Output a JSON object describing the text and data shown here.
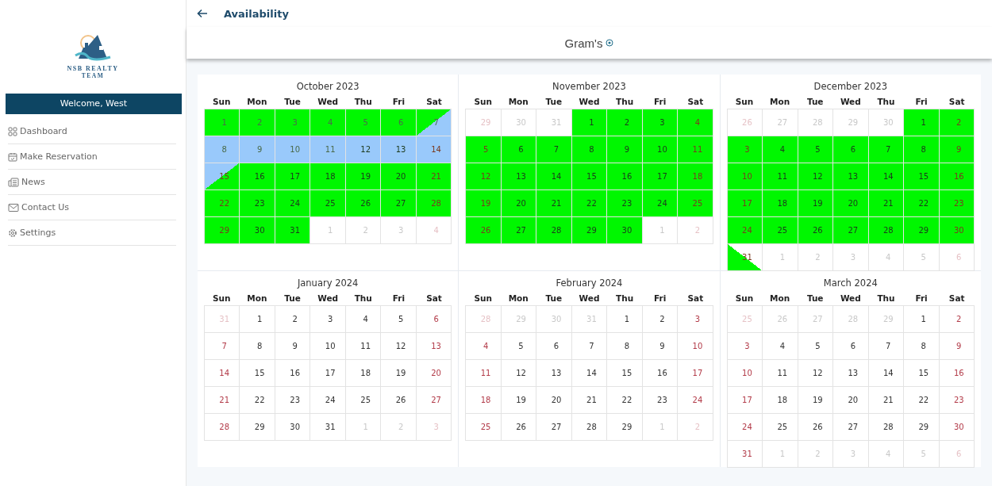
{
  "sidebar": {
    "logo_text": "NSB REALTY",
    "logo_subtext": "TEAM",
    "welcome": "Welcome, West",
    "items": [
      {
        "label": "Dashboard"
      },
      {
        "label": "Make Reservation"
      },
      {
        "label": "News"
      },
      {
        "label": "Contact Us"
      },
      {
        "label": "Settings"
      }
    ]
  },
  "header": {
    "title": "Availability",
    "property": "Gram's"
  },
  "months": [
    {
      "title": "October 2023",
      "weekdays": [
        "Sun",
        "Mon",
        "Tue",
        "Wed",
        "Thu",
        "Fri",
        "Sat"
      ],
      "weeks": [
        [
          {
            "d": "1",
            "kind": "green",
            "dim": true
          },
          {
            "d": "2",
            "kind": "green",
            "dim": true
          },
          {
            "d": "3",
            "kind": "green",
            "dim": true
          },
          {
            "d": "4",
            "kind": "green",
            "dim": true
          },
          {
            "d": "5",
            "kind": "green",
            "dim": true
          },
          {
            "d": "6",
            "kind": "green",
            "dim": true
          },
          {
            "d": "7",
            "kind": "green-blue",
            "dim": true
          }
        ],
        [
          {
            "d": "8",
            "kind": "blue",
            "dim": true
          },
          {
            "d": "9",
            "kind": "blue",
            "dim": true
          },
          {
            "d": "10",
            "kind": "blue",
            "dim": true
          },
          {
            "d": "11",
            "kind": "blue",
            "dim": true
          },
          {
            "d": "12",
            "kind": "blue",
            "dim": false
          },
          {
            "d": "13",
            "kind": "blue",
            "dim": false
          },
          {
            "d": "14",
            "kind": "blue",
            "dim": false
          }
        ],
        [
          {
            "d": "15",
            "kind": "blue-green",
            "dim": false
          },
          {
            "d": "16",
            "kind": "green",
            "dim": false
          },
          {
            "d": "17",
            "kind": "green",
            "dim": false
          },
          {
            "d": "18",
            "kind": "green",
            "dim": false
          },
          {
            "d": "19",
            "kind": "green",
            "dim": false
          },
          {
            "d": "20",
            "kind": "green",
            "dim": false
          },
          {
            "d": "21",
            "kind": "green",
            "dim": false
          }
        ],
        [
          {
            "d": "22",
            "kind": "green",
            "dim": false
          },
          {
            "d": "23",
            "kind": "green",
            "dim": false
          },
          {
            "d": "24",
            "kind": "green",
            "dim": false
          },
          {
            "d": "25",
            "kind": "green",
            "dim": false
          },
          {
            "d": "26",
            "kind": "green",
            "dim": false
          },
          {
            "d": "27",
            "kind": "green",
            "dim": false
          },
          {
            "d": "28",
            "kind": "green",
            "dim": false
          }
        ],
        [
          {
            "d": "29",
            "kind": "green",
            "dim": false
          },
          {
            "d": "30",
            "kind": "green",
            "dim": false
          },
          {
            "d": "31",
            "kind": "green",
            "dim": false
          },
          {
            "d": "1",
            "kind": "free",
            "dim": true
          },
          {
            "d": "2",
            "kind": "free",
            "dim": true
          },
          {
            "d": "3",
            "kind": "free",
            "dim": true
          },
          {
            "d": "4",
            "kind": "free",
            "dim": true
          }
        ]
      ]
    },
    {
      "title": "November 2023",
      "weekdays": [
        "Sun",
        "Mon",
        "Tue",
        "Wed",
        "Thu",
        "Fri",
        "Sat"
      ],
      "weeks": [
        [
          {
            "d": "29",
            "kind": "free",
            "dim": true
          },
          {
            "d": "30",
            "kind": "free",
            "dim": true
          },
          {
            "d": "31",
            "kind": "free",
            "dim": true
          },
          {
            "d": "1",
            "kind": "green",
            "dim": false
          },
          {
            "d": "2",
            "kind": "green",
            "dim": false
          },
          {
            "d": "3",
            "kind": "green",
            "dim": false
          },
          {
            "d": "4",
            "kind": "green",
            "dim": false
          }
        ],
        [
          {
            "d": "5",
            "kind": "green",
            "dim": false
          },
          {
            "d": "6",
            "kind": "green",
            "dim": false
          },
          {
            "d": "7",
            "kind": "green",
            "dim": false
          },
          {
            "d": "8",
            "kind": "green",
            "dim": false
          },
          {
            "d": "9",
            "kind": "green",
            "dim": false
          },
          {
            "d": "10",
            "kind": "green",
            "dim": false
          },
          {
            "d": "11",
            "kind": "green",
            "dim": false
          }
        ],
        [
          {
            "d": "12",
            "kind": "green",
            "dim": false
          },
          {
            "d": "13",
            "kind": "green",
            "dim": false
          },
          {
            "d": "14",
            "kind": "green",
            "dim": false
          },
          {
            "d": "15",
            "kind": "green",
            "dim": false
          },
          {
            "d": "16",
            "kind": "green",
            "dim": false
          },
          {
            "d": "17",
            "kind": "green",
            "dim": false
          },
          {
            "d": "18",
            "kind": "green",
            "dim": false
          }
        ],
        [
          {
            "d": "19",
            "kind": "green",
            "dim": false
          },
          {
            "d": "20",
            "kind": "green",
            "dim": false
          },
          {
            "d": "21",
            "kind": "green",
            "dim": false
          },
          {
            "d": "22",
            "kind": "green",
            "dim": false
          },
          {
            "d": "23",
            "kind": "green",
            "dim": false
          },
          {
            "d": "24",
            "kind": "green",
            "dim": false
          },
          {
            "d": "25",
            "kind": "green",
            "dim": false
          }
        ],
        [
          {
            "d": "26",
            "kind": "green",
            "dim": false
          },
          {
            "d": "27",
            "kind": "green",
            "dim": false
          },
          {
            "d": "28",
            "kind": "green",
            "dim": false
          },
          {
            "d": "29",
            "kind": "green",
            "dim": false
          },
          {
            "d": "30",
            "kind": "green",
            "dim": false
          },
          {
            "d": "1",
            "kind": "free",
            "dim": true
          },
          {
            "d": "2",
            "kind": "free",
            "dim": true
          }
        ]
      ]
    },
    {
      "title": "December 2023",
      "weekdays": [
        "Sun",
        "Mon",
        "Tue",
        "Wed",
        "Thu",
        "Fri",
        "Sat"
      ],
      "weeks": [
        [
          {
            "d": "26",
            "kind": "free",
            "dim": true
          },
          {
            "d": "27",
            "kind": "free",
            "dim": true
          },
          {
            "d": "28",
            "kind": "free",
            "dim": true
          },
          {
            "d": "29",
            "kind": "free",
            "dim": true
          },
          {
            "d": "30",
            "kind": "free",
            "dim": true
          },
          {
            "d": "1",
            "kind": "green",
            "dim": false
          },
          {
            "d": "2",
            "kind": "green",
            "dim": false
          }
        ],
        [
          {
            "d": "3",
            "kind": "green",
            "dim": false
          },
          {
            "d": "4",
            "kind": "green",
            "dim": false
          },
          {
            "d": "5",
            "kind": "green",
            "dim": false
          },
          {
            "d": "6",
            "kind": "green",
            "dim": false
          },
          {
            "d": "7",
            "kind": "green",
            "dim": false
          },
          {
            "d": "8",
            "kind": "green",
            "dim": false
          },
          {
            "d": "9",
            "kind": "green",
            "dim": false
          }
        ],
        [
          {
            "d": "10",
            "kind": "green",
            "dim": false
          },
          {
            "d": "11",
            "kind": "green",
            "dim": false
          },
          {
            "d": "12",
            "kind": "green",
            "dim": false
          },
          {
            "d": "13",
            "kind": "green",
            "dim": false
          },
          {
            "d": "14",
            "kind": "green",
            "dim": false
          },
          {
            "d": "15",
            "kind": "green",
            "dim": false
          },
          {
            "d": "16",
            "kind": "green",
            "dim": false
          }
        ],
        [
          {
            "d": "17",
            "kind": "green",
            "dim": false
          },
          {
            "d": "18",
            "kind": "green",
            "dim": false
          },
          {
            "d": "19",
            "kind": "green",
            "dim": false
          },
          {
            "d": "20",
            "kind": "green",
            "dim": false
          },
          {
            "d": "21",
            "kind": "green",
            "dim": false
          },
          {
            "d": "22",
            "kind": "green",
            "dim": false
          },
          {
            "d": "23",
            "kind": "green",
            "dim": false
          }
        ],
        [
          {
            "d": "24",
            "kind": "green",
            "dim": false
          },
          {
            "d": "25",
            "kind": "green",
            "dim": false
          },
          {
            "d": "26",
            "kind": "green",
            "dim": false
          },
          {
            "d": "27",
            "kind": "green",
            "dim": false
          },
          {
            "d": "28",
            "kind": "green",
            "dim": false
          },
          {
            "d": "29",
            "kind": "green",
            "dim": false
          },
          {
            "d": "30",
            "kind": "green",
            "dim": false
          }
        ],
        [
          {
            "d": "31",
            "kind": "green-free",
            "dim": false
          },
          {
            "d": "1",
            "kind": "free",
            "dim": true
          },
          {
            "d": "2",
            "kind": "free",
            "dim": true
          },
          {
            "d": "3",
            "kind": "free",
            "dim": true
          },
          {
            "d": "4",
            "kind": "free",
            "dim": true
          },
          {
            "d": "5",
            "kind": "free",
            "dim": true
          },
          {
            "d": "6",
            "kind": "free",
            "dim": true
          }
        ]
      ]
    },
    {
      "title": "January 2024",
      "weekdays": [
        "Sun",
        "Mon",
        "Tue",
        "Wed",
        "Thu",
        "Fri",
        "Sat"
      ],
      "weeks": [
        [
          {
            "d": "31",
            "kind": "free",
            "dim": true
          },
          {
            "d": "1",
            "kind": "free",
            "dim": false
          },
          {
            "d": "2",
            "kind": "free",
            "dim": false
          },
          {
            "d": "3",
            "kind": "free",
            "dim": false
          },
          {
            "d": "4",
            "kind": "free",
            "dim": false
          },
          {
            "d": "5",
            "kind": "free",
            "dim": false
          },
          {
            "d": "6",
            "kind": "free",
            "dim": false
          }
        ],
        [
          {
            "d": "7",
            "kind": "free",
            "dim": false
          },
          {
            "d": "8",
            "kind": "free",
            "dim": false
          },
          {
            "d": "9",
            "kind": "free",
            "dim": false
          },
          {
            "d": "10",
            "kind": "free",
            "dim": false
          },
          {
            "d": "11",
            "kind": "free",
            "dim": false
          },
          {
            "d": "12",
            "kind": "free",
            "dim": false
          },
          {
            "d": "13",
            "kind": "free",
            "dim": false
          }
        ],
        [
          {
            "d": "14",
            "kind": "free",
            "dim": false
          },
          {
            "d": "15",
            "kind": "free",
            "dim": false
          },
          {
            "d": "16",
            "kind": "free",
            "dim": false
          },
          {
            "d": "17",
            "kind": "free",
            "dim": false
          },
          {
            "d": "18",
            "kind": "free",
            "dim": false
          },
          {
            "d": "19",
            "kind": "free",
            "dim": false
          },
          {
            "d": "20",
            "kind": "free",
            "dim": false
          }
        ],
        [
          {
            "d": "21",
            "kind": "free",
            "dim": false
          },
          {
            "d": "22",
            "kind": "free",
            "dim": false
          },
          {
            "d": "23",
            "kind": "free",
            "dim": false
          },
          {
            "d": "24",
            "kind": "free",
            "dim": false
          },
          {
            "d": "25",
            "kind": "free",
            "dim": false
          },
          {
            "d": "26",
            "kind": "free",
            "dim": false
          },
          {
            "d": "27",
            "kind": "free",
            "dim": false
          }
        ],
        [
          {
            "d": "28",
            "kind": "free",
            "dim": false
          },
          {
            "d": "29",
            "kind": "free",
            "dim": false
          },
          {
            "d": "30",
            "kind": "free",
            "dim": false
          },
          {
            "d": "31",
            "kind": "free",
            "dim": false
          },
          {
            "d": "1",
            "kind": "free",
            "dim": true
          },
          {
            "d": "2",
            "kind": "free",
            "dim": true
          },
          {
            "d": "3",
            "kind": "free",
            "dim": true
          }
        ]
      ]
    },
    {
      "title": "February 2024",
      "weekdays": [
        "Sun",
        "Mon",
        "Tue",
        "Wed",
        "Thu",
        "Fri",
        "Sat"
      ],
      "weeks": [
        [
          {
            "d": "28",
            "kind": "free",
            "dim": true
          },
          {
            "d": "29",
            "kind": "free",
            "dim": true
          },
          {
            "d": "30",
            "kind": "free",
            "dim": true
          },
          {
            "d": "31",
            "kind": "free",
            "dim": true
          },
          {
            "d": "1",
            "kind": "free",
            "dim": false
          },
          {
            "d": "2",
            "kind": "free",
            "dim": false
          },
          {
            "d": "3",
            "kind": "free",
            "dim": false
          }
        ],
        [
          {
            "d": "4",
            "kind": "free",
            "dim": false
          },
          {
            "d": "5",
            "kind": "free",
            "dim": false
          },
          {
            "d": "6",
            "kind": "free",
            "dim": false
          },
          {
            "d": "7",
            "kind": "free",
            "dim": false
          },
          {
            "d": "8",
            "kind": "free",
            "dim": false
          },
          {
            "d": "9",
            "kind": "free",
            "dim": false
          },
          {
            "d": "10",
            "kind": "free",
            "dim": false
          }
        ],
        [
          {
            "d": "11",
            "kind": "free",
            "dim": false
          },
          {
            "d": "12",
            "kind": "free",
            "dim": false
          },
          {
            "d": "13",
            "kind": "free",
            "dim": false
          },
          {
            "d": "14",
            "kind": "free",
            "dim": false
          },
          {
            "d": "15",
            "kind": "free",
            "dim": false
          },
          {
            "d": "16",
            "kind": "free",
            "dim": false
          },
          {
            "d": "17",
            "kind": "free",
            "dim": false
          }
        ],
        [
          {
            "d": "18",
            "kind": "free",
            "dim": false
          },
          {
            "d": "19",
            "kind": "free",
            "dim": false
          },
          {
            "d": "20",
            "kind": "free",
            "dim": false
          },
          {
            "d": "21",
            "kind": "free",
            "dim": false
          },
          {
            "d": "22",
            "kind": "free",
            "dim": false
          },
          {
            "d": "23",
            "kind": "free",
            "dim": false
          },
          {
            "d": "24",
            "kind": "free",
            "dim": false
          }
        ],
        [
          {
            "d": "25",
            "kind": "free",
            "dim": false
          },
          {
            "d": "26",
            "kind": "free",
            "dim": false
          },
          {
            "d": "27",
            "kind": "free",
            "dim": false
          },
          {
            "d": "28",
            "kind": "free",
            "dim": false
          },
          {
            "d": "29",
            "kind": "free",
            "dim": false
          },
          {
            "d": "1",
            "kind": "free",
            "dim": true
          },
          {
            "d": "2",
            "kind": "free",
            "dim": true
          }
        ]
      ]
    },
    {
      "title": "March 2024",
      "weekdays": [
        "Sun",
        "Mon",
        "Tue",
        "Wed",
        "Thu",
        "Fri",
        "Sat"
      ],
      "weeks": [
        [
          {
            "d": "25",
            "kind": "free",
            "dim": true
          },
          {
            "d": "26",
            "kind": "free",
            "dim": true
          },
          {
            "d": "27",
            "kind": "free",
            "dim": true
          },
          {
            "d": "28",
            "kind": "free",
            "dim": true
          },
          {
            "d": "29",
            "kind": "free",
            "dim": true
          },
          {
            "d": "1",
            "kind": "free",
            "dim": false
          },
          {
            "d": "2",
            "kind": "free",
            "dim": false
          }
        ],
        [
          {
            "d": "3",
            "kind": "free",
            "dim": false
          },
          {
            "d": "4",
            "kind": "free",
            "dim": false
          },
          {
            "d": "5",
            "kind": "free",
            "dim": false
          },
          {
            "d": "6",
            "kind": "free",
            "dim": false
          },
          {
            "d": "7",
            "kind": "free",
            "dim": false
          },
          {
            "d": "8",
            "kind": "free",
            "dim": false
          },
          {
            "d": "9",
            "kind": "free",
            "dim": false
          }
        ],
        [
          {
            "d": "10",
            "kind": "free",
            "dim": false
          },
          {
            "d": "11",
            "kind": "free",
            "dim": false
          },
          {
            "d": "12",
            "kind": "free",
            "dim": false
          },
          {
            "d": "13",
            "kind": "free",
            "dim": false
          },
          {
            "d": "14",
            "kind": "free",
            "dim": false
          },
          {
            "d": "15",
            "kind": "free",
            "dim": false
          },
          {
            "d": "16",
            "kind": "free",
            "dim": false
          }
        ],
        [
          {
            "d": "17",
            "kind": "free",
            "dim": false
          },
          {
            "d": "18",
            "kind": "free",
            "dim": false
          },
          {
            "d": "19",
            "kind": "free",
            "dim": false
          },
          {
            "d": "20",
            "kind": "free",
            "dim": false
          },
          {
            "d": "21",
            "kind": "free",
            "dim": false
          },
          {
            "d": "22",
            "kind": "free",
            "dim": false
          },
          {
            "d": "23",
            "kind": "free",
            "dim": false
          }
        ],
        [
          {
            "d": "24",
            "kind": "free",
            "dim": false
          },
          {
            "d": "25",
            "kind": "free",
            "dim": false
          },
          {
            "d": "26",
            "kind": "free",
            "dim": false
          },
          {
            "d": "27",
            "kind": "free",
            "dim": false
          },
          {
            "d": "28",
            "kind": "free",
            "dim": false
          },
          {
            "d": "29",
            "kind": "free",
            "dim": false
          },
          {
            "d": "30",
            "kind": "free",
            "dim": false
          }
        ],
        [
          {
            "d": "31",
            "kind": "free",
            "dim": false
          },
          {
            "d": "1",
            "kind": "free",
            "dim": true
          },
          {
            "d": "2",
            "kind": "free",
            "dim": true
          },
          {
            "d": "3",
            "kind": "free",
            "dim": true
          },
          {
            "d": "4",
            "kind": "free",
            "dim": true
          },
          {
            "d": "5",
            "kind": "free",
            "dim": true
          },
          {
            "d": "6",
            "kind": "free",
            "dim": true
          }
        ]
      ]
    }
  ]
}
